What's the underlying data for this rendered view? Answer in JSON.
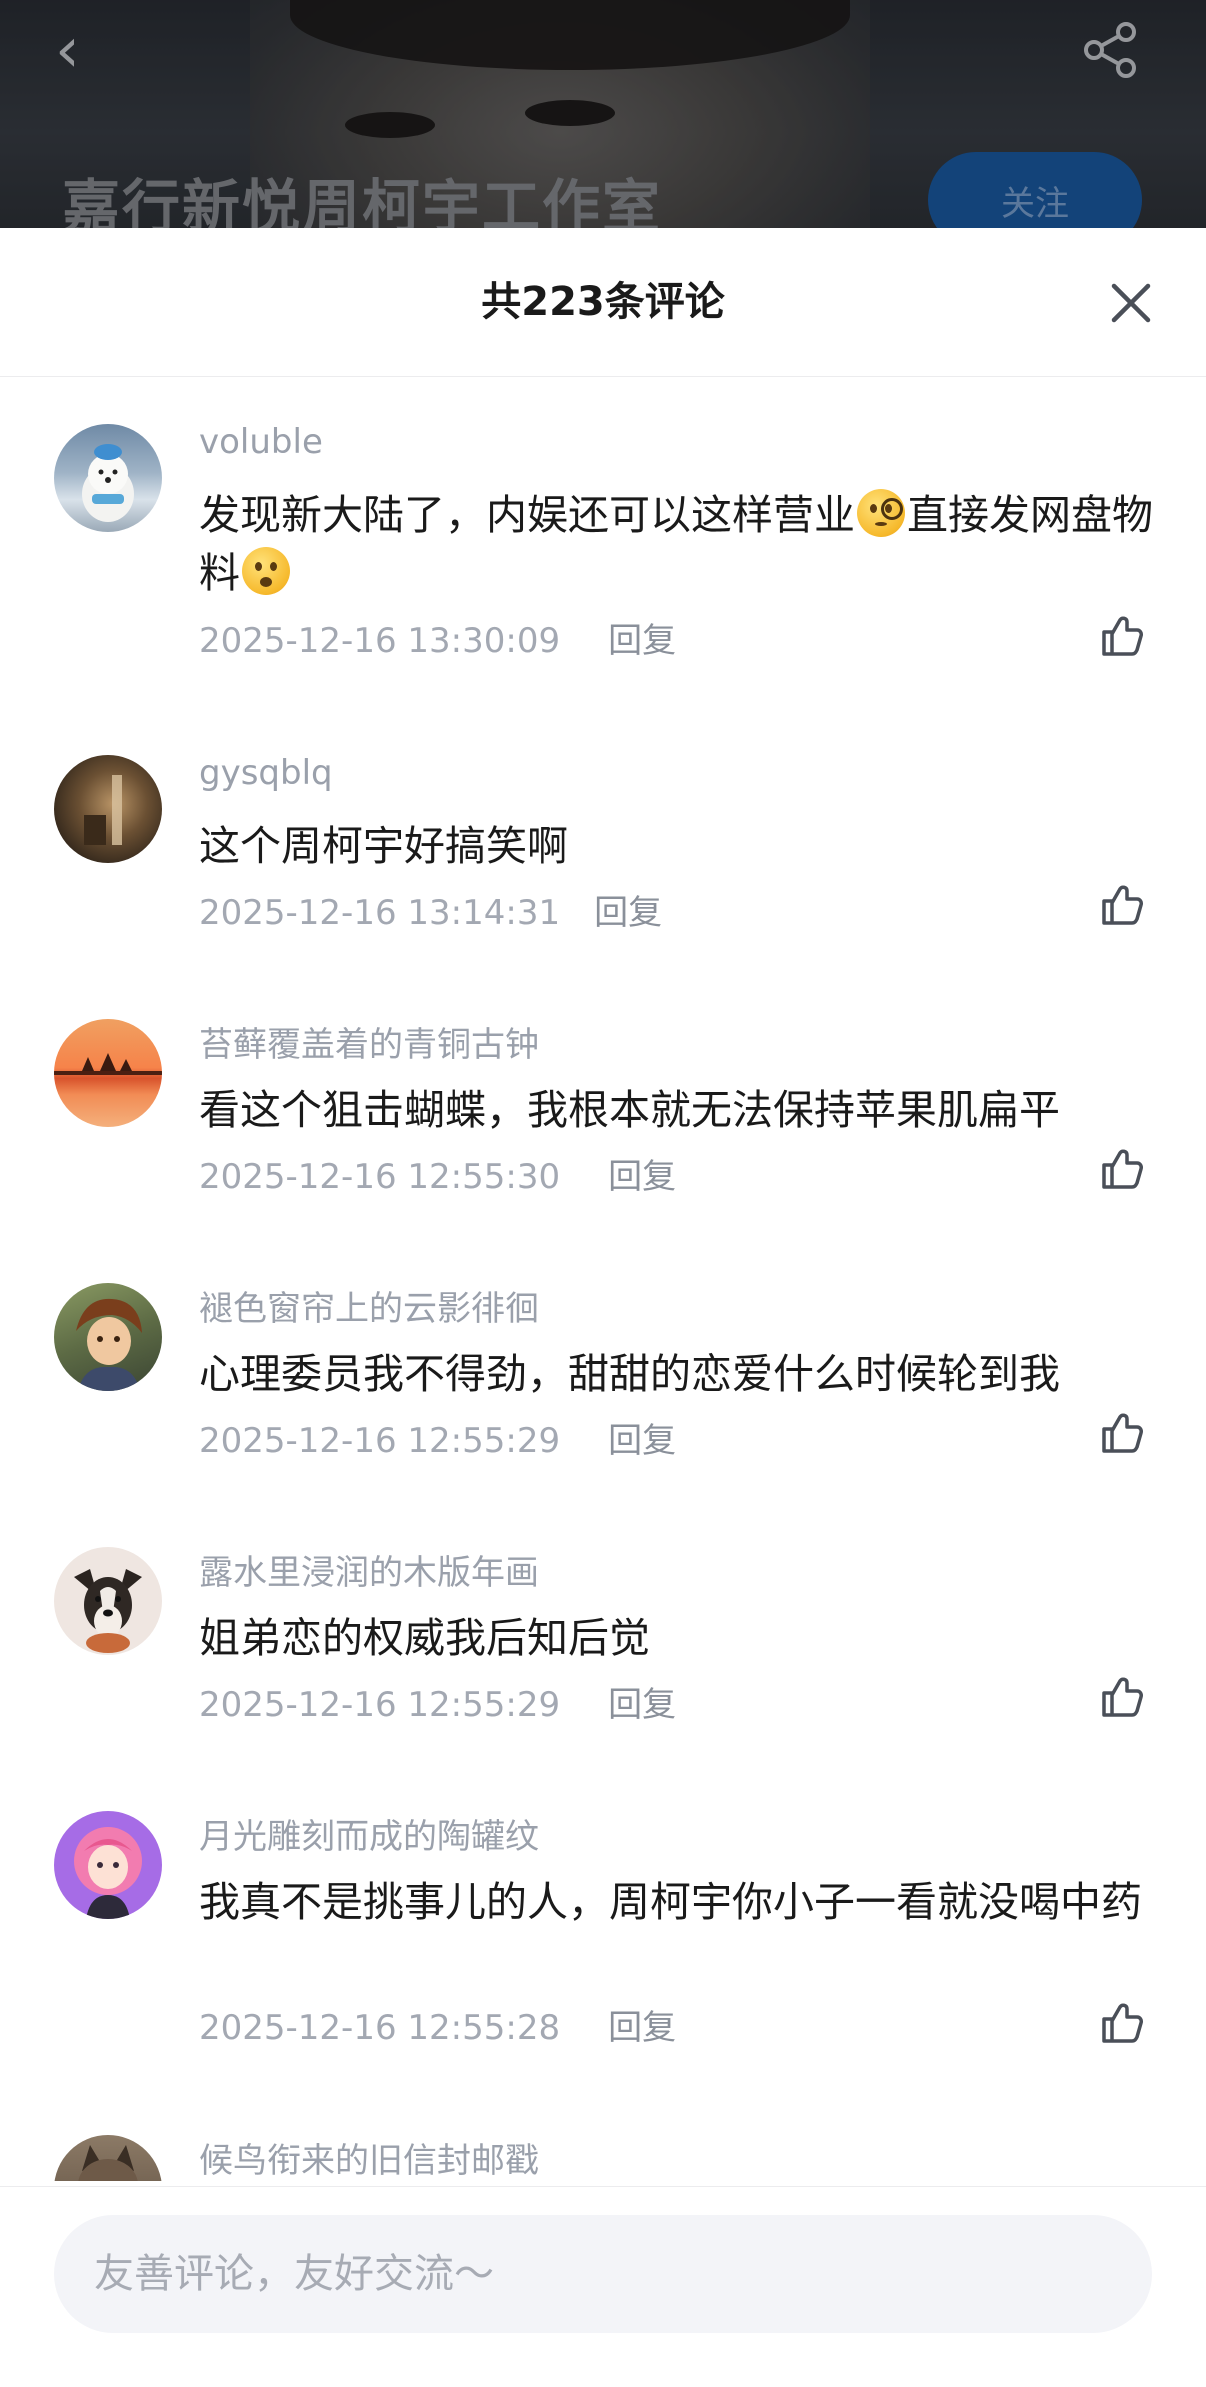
{
  "background": {
    "account_name": "嘉行新悦周柯宇工作室",
    "follow_label": "关注"
  },
  "sheet": {
    "title": "共223条评论"
  },
  "comments": [
    {
      "username": "voluble",
      "text_parts": [
        "发现新大陆了，内娱还可以这样营业",
        "直接发网盘物料"
      ],
      "emojis": [
        "monocle-face-emoji",
        "astonished-face-emoji"
      ],
      "timestamp": "2025-12-16 13:30:09",
      "reply_label": "回复",
      "avatar": "white-dog-avatar"
    },
    {
      "username": "gysqblq",
      "text": "这个周柯宇好搞笑啊",
      "timestamp": "2025-12-16 13:14:31",
      "reply_label": "回复",
      "avatar": "dark-room-avatar"
    },
    {
      "username": "苔藓覆盖着的青铜古钟",
      "text": "看这个狙击蝴蝶，我根本就无法保持苹果肌扁平",
      "timestamp": "2025-12-16 12:55:30",
      "reply_label": "回复",
      "avatar": "sunset-avatar"
    },
    {
      "username": "褪色窗帘上的云影徘徊",
      "text": "心理委员我不得劲，甜甜的恋爱什么时候轮到我",
      "timestamp": "2025-12-16 12:55:29",
      "reply_label": "回复",
      "avatar": "anime-boy-avatar"
    },
    {
      "username": "露水里浸润的木版年画",
      "text": "姐弟恋的权威我后知后觉",
      "timestamp": "2025-12-16 12:55:29",
      "reply_label": "回复",
      "avatar": "dog-avatar"
    },
    {
      "username": "月光雕刻而成的陶罐纹",
      "text": "我真不是挑事儿的人，周柯宇你小子一看就没喝中药",
      "timestamp": "2025-12-16 12:55:28",
      "reply_label": "回复",
      "avatar": "pink-cartoon-avatar"
    },
    {
      "username": "候鸟衔来的旧信封邮戳",
      "avatar": "cat-avatar"
    }
  ],
  "input": {
    "placeholder": "友善评论，友好交流～"
  },
  "colors": {
    "accent_follow": "#1b5ea8",
    "meta_text": "#a3a8b2",
    "input_bg": "#f3f4f8"
  }
}
